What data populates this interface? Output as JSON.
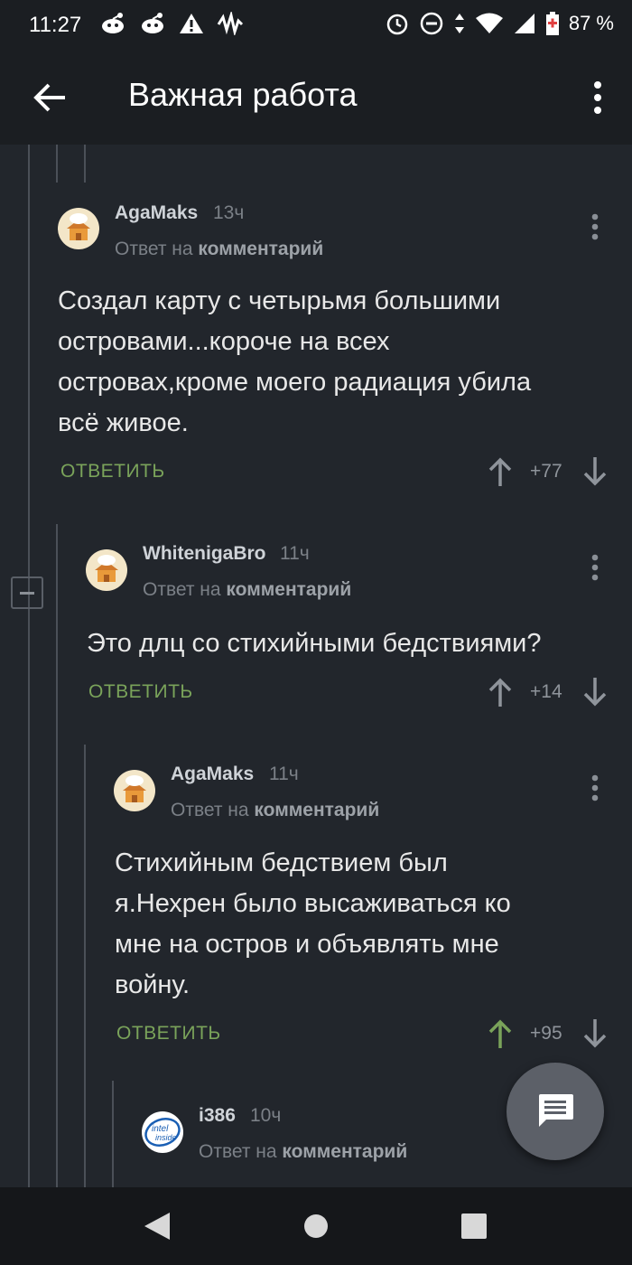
{
  "status": {
    "time": "11:27",
    "battery": "87 %"
  },
  "appbar": {
    "title": "Важная работа"
  },
  "comments": [
    {
      "username": "AgaMaks",
      "age": "13ч",
      "reply_prefix": "Ответ на ",
      "reply_target": "комментарий",
      "lines": [
        "Создал карту с четырьмя большими",
        "островами...короче на всех",
        "островах,кроме моего радиация убила",
        "всё живое."
      ],
      "reply_label": "ОТВЕТИТЬ",
      "score": "+77",
      "upvoted": false
    },
    {
      "username": "WhitenigaBro",
      "age": "11ч",
      "reply_prefix": "Ответ на ",
      "reply_target": "комментарий",
      "lines": [
        "Это длц со стихийными бедствиями?"
      ],
      "reply_label": "ОТВЕТИТЬ",
      "score": "+14",
      "upvoted": false
    },
    {
      "username": "AgaMaks",
      "age": "11ч",
      "reply_prefix": "Ответ на ",
      "reply_target": "комментарий",
      "lines": [
        "Стихийным бедствием был",
        "я.Нехрен было высаживаться ко",
        "мне на остров и объявлять мне",
        "войну."
      ],
      "reply_label": "ОТВЕТИТЬ",
      "score": "+95",
      "upvoted": true
    },
    {
      "username": "i386",
      "age": "10ч",
      "reply_prefix": "Ответ на ",
      "reply_target": "комментарий",
      "avatar_text": [
        "intel",
        "inside"
      ]
    }
  ],
  "colors": {
    "background": "#22262c",
    "bar": "#1b1e22",
    "reply": "#7aa35a",
    "upvote_active": "#7aa35a"
  },
  "icons": [
    "back-arrow-icon",
    "more-vert-icon",
    "arrow-up-icon",
    "arrow-down-icon",
    "minus-icon",
    "chat-icon",
    "nav-back-icon",
    "nav-home-icon",
    "nav-recents-icon"
  ]
}
